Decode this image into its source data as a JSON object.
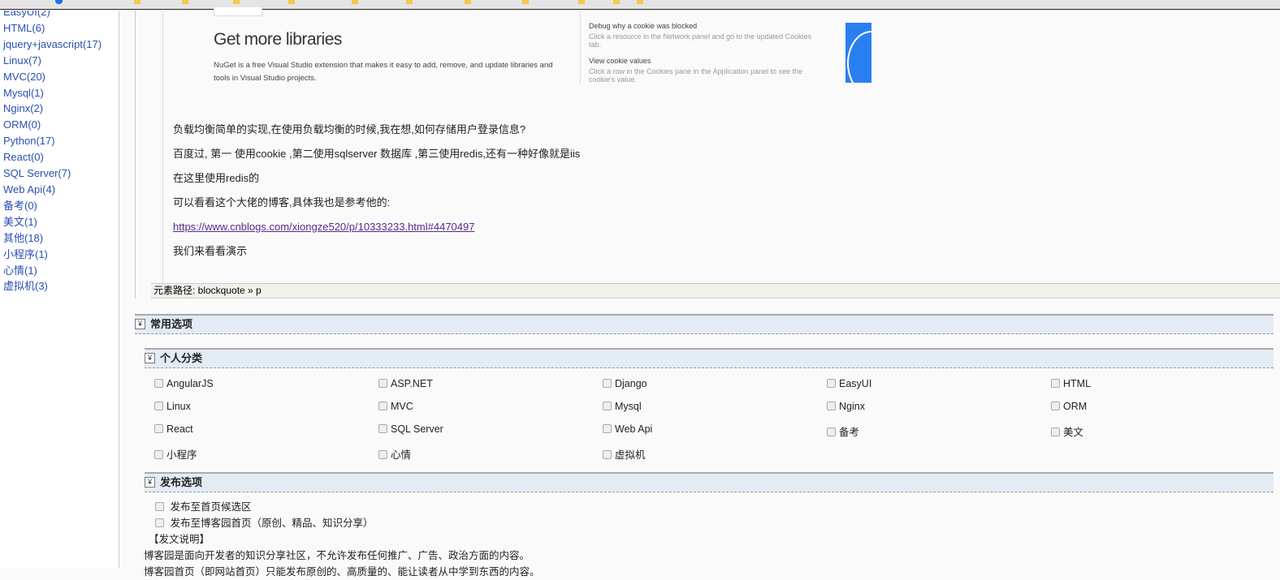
{
  "sidebar": {
    "items": [
      "EasyUI(2)",
      "HTML(6)",
      "jquery+javascript(17)",
      "Linux(7)",
      "MVC(20)",
      "Mysql(1)",
      "Nginx(2)",
      "ORM(0)",
      "Python(17)",
      "React(0)",
      "SQL Server(7)",
      "Web Api(4)",
      "备考(0)",
      "美文(1)",
      "其他(18)",
      "小程序(1)",
      "心情(1)",
      "虚拟机(3)"
    ]
  },
  "editor": {
    "image": {
      "title": "Get more libraries",
      "desc": "NuGet is a free Visual Studio extension that makes it easy to add, remove, and update libraries and tools in Visual Studio projects.",
      "cookie1_title": "Debug why a cookie was blocked",
      "cookie1_desc": "Click a resource in the Network panel and go to the updated Cookies tab.",
      "cookie2_title": "View cookie values",
      "cookie2_desc": "Click a row in the Cookies pane in the Application panel to see the cookie's value."
    },
    "paragraphs": [
      "负载均衡简单的实现,在使用负载均衡的时候,我在想,如何存储用户登录信息?",
      "百度过, 第一 使用cookie ,第二使用sqlserver 数据库 ,第三使用redis,还有一种好像就是iis",
      "在这里使用redis的",
      "可以看看这个大佬的博客,具体我也是参考他的:"
    ],
    "link": "https://www.cnblogs.com/xiongze520/p/10333233.html#4470497",
    "last_paragraph": "我们来看看演示",
    "element_path": "元素路径: blockquote » p"
  },
  "sections": {
    "common": "常用选项",
    "personal": "个人分类",
    "publish": "发布选项",
    "toggle_icon": "double-chevron-down"
  },
  "categories": [
    [
      "AngularJS",
      "ASP.NET",
      "Django",
      "EasyUI",
      "HTML"
    ],
    [
      "Linux",
      "MVC",
      "Mysql",
      "Nginx",
      "ORM"
    ],
    [
      "React",
      "SQL Server",
      "Web Api",
      "备考",
      "美文"
    ],
    [
      "小程序",
      "心情",
      "虚拟机"
    ]
  ],
  "publish": {
    "opt1": "发布至首页候选区",
    "opt2": "发布至博客园首页（原创、精品、知识分享）",
    "note_title": "【发文说明】",
    "note1": "博客园是面向开发者的知识分享社区，不允许发布任何推广、广告、政治方面的内容。",
    "note2": "博客园首页（即网站首页）只能发布原创的、高质量的、能让读者从中学到东西的内容。"
  }
}
